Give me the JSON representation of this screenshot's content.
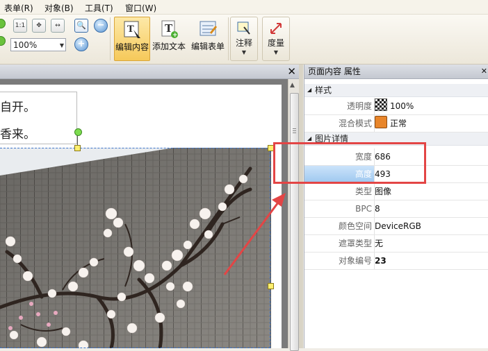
{
  "menu": [
    "表单(R)",
    "对象(B)",
    "工具(T)",
    "窗口(W)"
  ],
  "toolbar": {
    "fit_label": "1:1",
    "zoom_value": "100%",
    "edit_content": "编辑内容",
    "add_text": "添加文本",
    "edit_form": "编辑表单",
    "annotate": "注释",
    "measure": "度量"
  },
  "document": {
    "lines": [
      "自开。",
      "香来。"
    ]
  },
  "props_panel": {
    "title": "页面内容 属性",
    "categories": {
      "style": "样式",
      "image_details": "图片详情"
    },
    "rows": [
      {
        "key": "透明度",
        "value": "100%"
      },
      {
        "key": "混合模式",
        "value": "正常"
      },
      {
        "key": "宽度",
        "value": "686"
      },
      {
        "key": "高度",
        "value": "493"
      },
      {
        "key": "类型",
        "value": "图像"
      },
      {
        "key": "BPC",
        "value": "8"
      },
      {
        "key": "颜色空间",
        "value": "DeviceRGB"
      },
      {
        "key": "遮罩类型",
        "value": "无"
      },
      {
        "key": "对象编号",
        "value": "23"
      }
    ]
  },
  "colors": {
    "highlight": "#9fc8ef",
    "annotation": "#e34545",
    "active_tool": "#f6c95a"
  }
}
